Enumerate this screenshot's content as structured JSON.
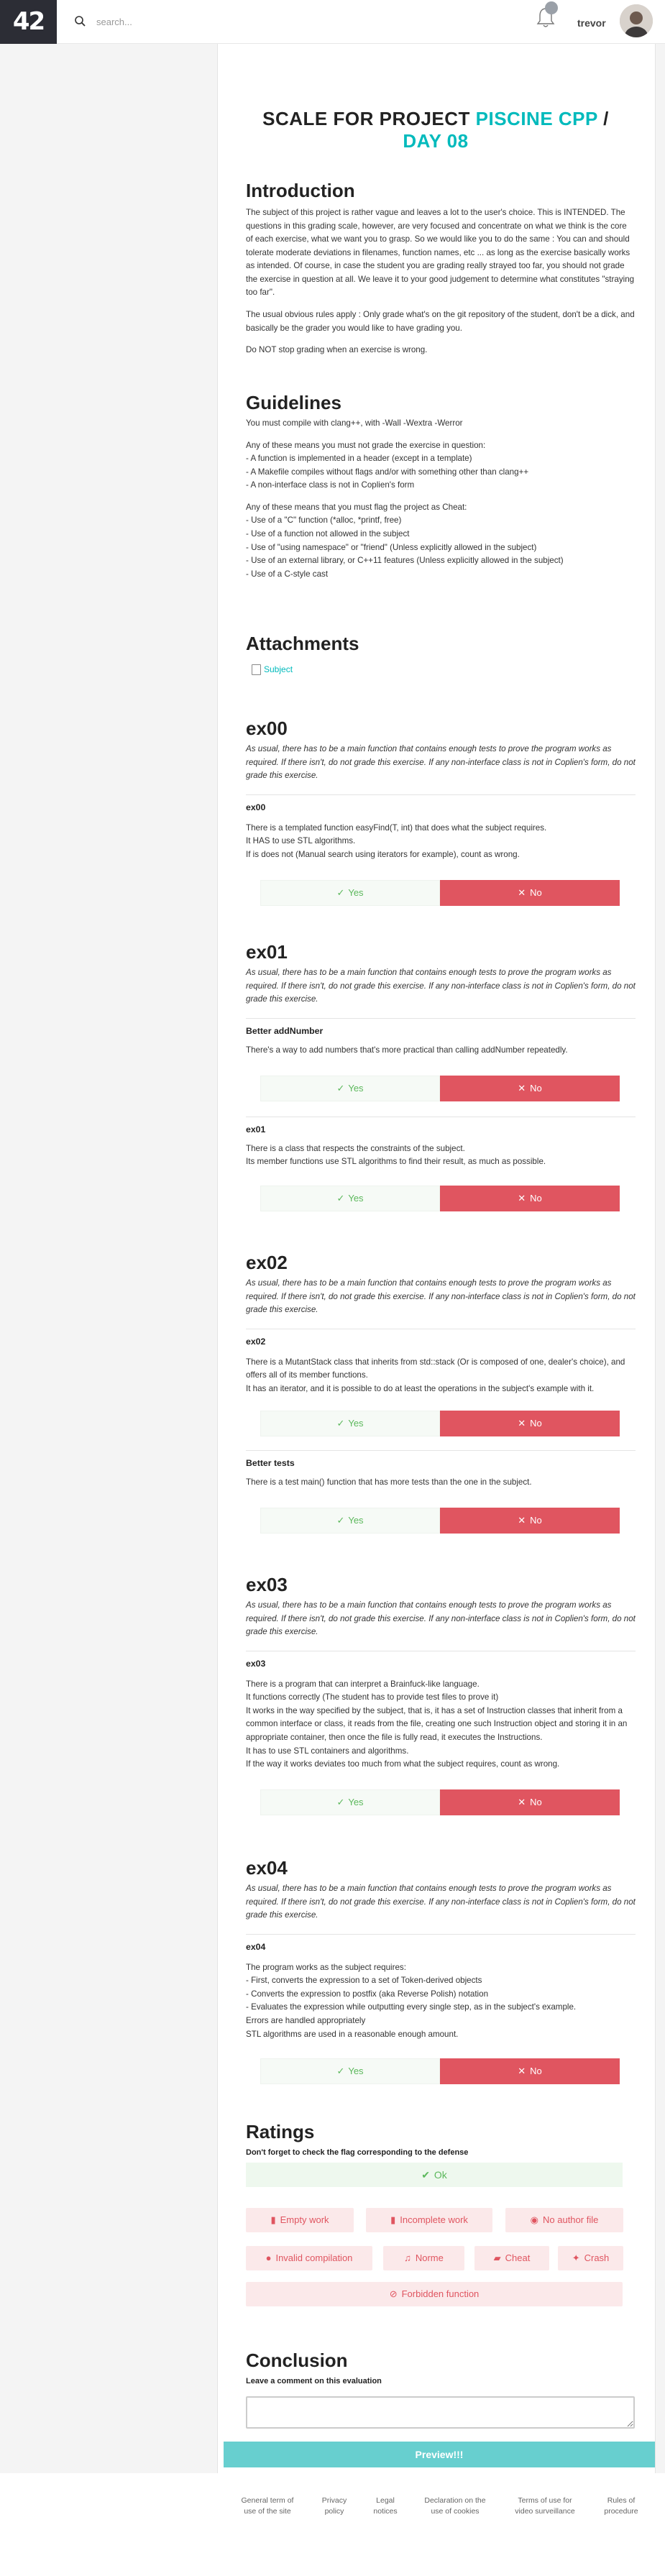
{
  "topbar": {
    "logo": "42",
    "search_placeholder": "search...",
    "notification_count": "",
    "username": "trevor"
  },
  "page": {
    "title_prefix": "SCALE FOR PROJECT ",
    "title_project": "PISCINE CPP",
    "title_sep": " / ",
    "title_day": "DAY 08"
  },
  "intro": {
    "heading": "Introduction",
    "p1": "The subject of this project is rather vague and leaves a lot to the user's choice. This is INTENDED. The questions in this grading scale, however, are very focused and concentrate on what we think is the core of each exercise, what we want you to grasp. So we would like you to do the same : You can and should tolerate moderate deviations in filenames, function names, etc ... as long as the exercise basically works as intended. Of course, in case the student you are grading really strayed too far, you should not grade the exercise in question at all. We leave it to your good judgement to determine what constitutes \"straying too far\".",
    "p2": "The usual obvious rules apply : Only grade what's on the git repository of the student, don't be a dick, and basically be the grader you would like to have grading you.",
    "p3": "Do NOT stop grading when an exercise is wrong."
  },
  "guidelines": {
    "heading": "Guidelines",
    "lines": [
      "You must compile with clang++, with -Wall -Wextra -Werror",
      "",
      "Any of these means you must not grade the exercise in question:",
      "- A function is implemented in a header (except in a template)",
      "- A Makefile compiles without flags and/or with something other than clang++",
      "- A non-interface class is not in Coplien's form",
      "",
      "Any of these means that you must flag the project as Cheat:",
      "- Use of a \"C\" function (*alloc, *printf, free)",
      "- Use of a function not allowed in the subject",
      "- Use of \"using namespace\" or \"friend\" (Unless explicitly allowed in the subject)",
      "- Use of an external library, or C++11 features (Unless explicitly allowed in the subject)",
      "- Use of a C-style cast"
    ]
  },
  "attachments": {
    "heading": "Attachments",
    "subject": "Subject"
  },
  "common_note": "As usual, there has to be a main function that contains enough tests to prove the program works as required. If there isn't, do not grade this exercise. If any non-interface class is not in Coplien's form, do not grade this exercise.",
  "buttons": {
    "yes": "Yes",
    "no": "No"
  },
  "exercises": [
    {
      "heading": "ex00",
      "questions": [
        {
          "title": "ex00",
          "lines": [
            "There is a templated function easyFind(T, int) that does what the subject requires.",
            "It HAS to use STL algorithms.",
            "If is does not (Manual search using iterators for example), count as wrong."
          ]
        }
      ]
    },
    {
      "heading": "ex01",
      "questions": [
        {
          "title": "Better addNumber",
          "lines": [
            "There's a way to add numbers that's more practical than calling addNumber repeatedly."
          ]
        },
        {
          "title": "ex01",
          "lines": [
            "There is a class that respects the constraints of the subject.",
            "Its member functions use STL algorithms to find their result, as much as possible."
          ]
        }
      ]
    },
    {
      "heading": "ex02",
      "questions": [
        {
          "title": "ex02",
          "lines": [
            "There is a MutantStack class that inherits from std::stack (Or is composed of one, dealer's choice), and offers all of its member functions.",
            "It has an iterator, and it is possible to do at least the operations in the subject's example with it."
          ]
        },
        {
          "title": "Better tests",
          "lines": [
            "There is a test main() function that has more tests than the one in the subject."
          ]
        }
      ]
    },
    {
      "heading": "ex03",
      "questions": [
        {
          "title": "ex03",
          "lines": [
            "There is a program that can interpret a Brainfuck-like language.",
            "It functions correctly (The student has to provide test files to prove it)",
            "It works in the way specified by the subject, that is, it has a set of Instruction classes that inherit from a common interface or class, it reads from the file, creating one such Instruction object and storing it in an appropriate container, then once the file is fully read, it executes the Instructions.",
            "It has to use STL containers and algorithms.",
            "If the way it works deviates too much from what the subject requires, count as wrong."
          ]
        }
      ]
    },
    {
      "heading": "ex04",
      "questions": [
        {
          "title": "ex04",
          "lines": [
            "The program works as the subject requires:",
            "- First, converts the expression to a set of Token-derived objects",
            "- Converts the expression to postfix (aka Reverse Polish) notation",
            "- Evaluates the expression while outputting every single step, as in the subject's example.",
            "Errors are handled appropriately",
            "STL algorithms are used in a reasonable enough amount."
          ]
        }
      ]
    }
  ],
  "ratings": {
    "heading": "Ratings",
    "note": "Don't forget to check the flag corresponding to the defense",
    "ok": "Ok",
    "flags": [
      "Empty work",
      "Incomplete work",
      "No author file",
      "Invalid compilation",
      "Norme",
      "Cheat",
      "Crash",
      "Forbidden function"
    ]
  },
  "conclusion": {
    "heading": "Conclusion",
    "label": "Leave a comment on this evaluation",
    "preview": "Preview!!!"
  },
  "footer": [
    "General term of use of the site",
    "Privacy policy",
    "Legal notices",
    "Declaration on the use of cookies",
    "Terms of use for video surveillance",
    "Rules of procedure"
  ],
  "colors": {
    "accent": "#00babc",
    "no": "#e05560",
    "yes": "#5cb85c",
    "sidebar": "#2c2d35"
  }
}
